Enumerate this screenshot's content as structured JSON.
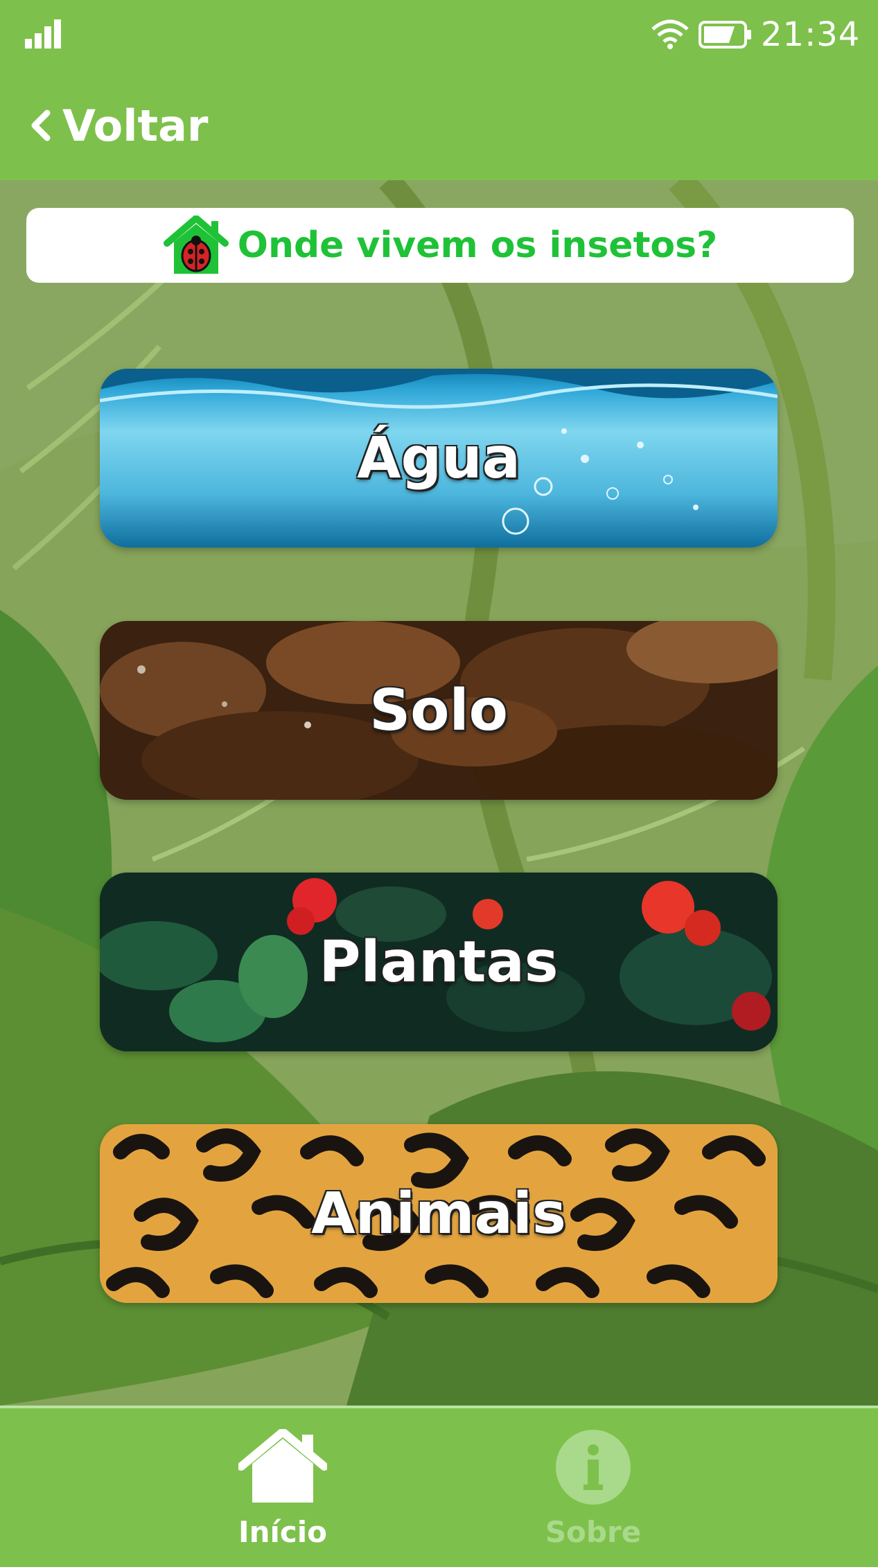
{
  "status_bar": {
    "time": "21:34"
  },
  "nav": {
    "back_label": "Voltar"
  },
  "header": {
    "title": "Onde vivem os insetos?"
  },
  "categories": [
    {
      "label": "Água"
    },
    {
      "label": "Solo"
    },
    {
      "label": "Plantas"
    },
    {
      "label": "Animais"
    }
  ],
  "tabs": [
    {
      "label": "Início",
      "active": true
    },
    {
      "label": "Sobre",
      "active": false
    }
  ],
  "colors": {
    "primary_green": "#7ec04c",
    "title_green": "#1fc237",
    "inactive_tab": "#a9d98a"
  }
}
